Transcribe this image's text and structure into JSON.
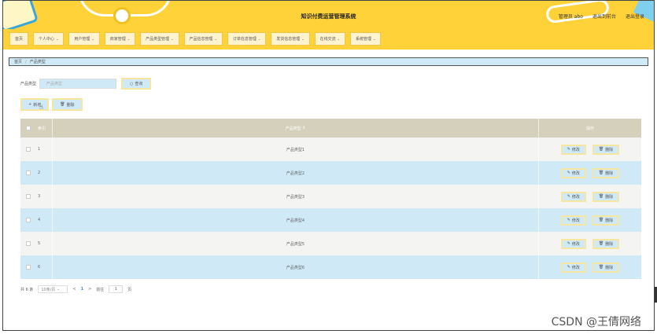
{
  "header": {
    "title": "知识付费运营管理系统",
    "user_label": "管理员 abo",
    "goto_front": "退出到前台",
    "logout": "退出登录"
  },
  "nav": {
    "items": [
      {
        "label": "首页",
        "caret": ""
      },
      {
        "label": "个人中心",
        "caret": "⌄"
      },
      {
        "label": "用户管理",
        "caret": "⌄"
      },
      {
        "label": "商家管理",
        "caret": "⌄"
      },
      {
        "label": "产品类型管理",
        "caret": "⌄"
      },
      {
        "label": "产品信息管理",
        "caret": "⌄"
      },
      {
        "label": "订单信息管理",
        "caret": "⌄"
      },
      {
        "label": "发货信息管理",
        "caret": "⌄"
      },
      {
        "label": "在线交流",
        "caret": "⌄"
      },
      {
        "label": "系统管理",
        "caret": "⌄"
      }
    ]
  },
  "breadcrumb": {
    "home": "首页",
    "separator": "/",
    "current": "产品类型"
  },
  "search": {
    "label": "产品类型",
    "placeholder": "产品类型",
    "button": "查询",
    "button_icon": "○"
  },
  "actions": {
    "add": "新增",
    "add_icon": "+",
    "delete": "删除",
    "delete_icon": "🗑"
  },
  "table": {
    "headers": {
      "index": "索引",
      "name": "产品类型",
      "name_sort": "⇕",
      "op": "操作"
    },
    "rows": [
      {
        "index": "1",
        "name": "产品类型1"
      },
      {
        "index": "2",
        "name": "产品类型2"
      },
      {
        "index": "3",
        "name": "产品类型3"
      },
      {
        "index": "4",
        "name": "产品类型4"
      },
      {
        "index": "5",
        "name": "产品类型5"
      },
      {
        "index": "6",
        "name": "产品类型6"
      }
    ],
    "edit_label": "修改",
    "edit_icon": "✎",
    "delete_label": "删除",
    "delete_icon": "🗑"
  },
  "pager": {
    "total": "共 6 条",
    "page_size": "10条/页",
    "prev": "<",
    "current": "1",
    "next": ">",
    "goto_label": "前往",
    "goto_value": "1",
    "page_unit": "页"
  },
  "watermark": "CSDN @王倩网络",
  "colors": {
    "header_bg": "#ffd23a",
    "light_blue": "#cfe9f7",
    "table_head": "#d4d0bb"
  }
}
